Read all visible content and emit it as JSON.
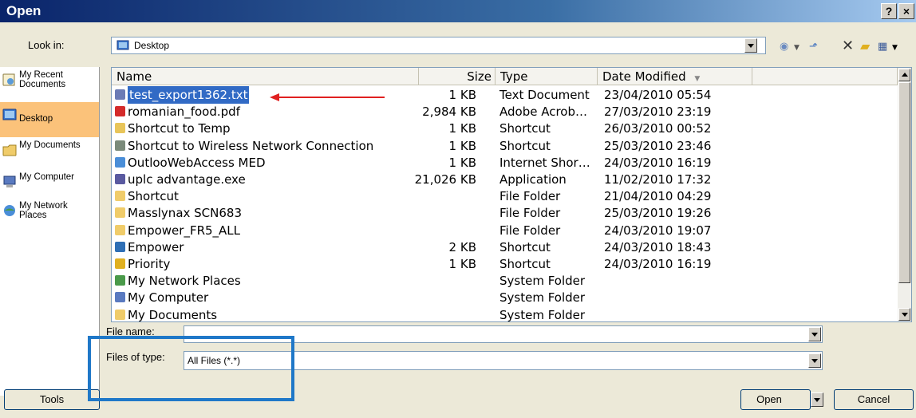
{
  "window": {
    "title": "Open",
    "help_glyph": "?",
    "close_glyph": "×"
  },
  "look_in": {
    "label": "Look in:",
    "value": "Desktop"
  },
  "places": [
    {
      "label": "My Recent Documents",
      "icon": "recent-documents-icon",
      "active": false
    },
    {
      "label": "Desktop",
      "icon": "desktop-icon",
      "active": true
    },
    {
      "label": "My Documents",
      "icon": "my-documents-icon",
      "active": false
    },
    {
      "label": "My Computer",
      "icon": "my-computer-icon",
      "active": false
    },
    {
      "label": "My Network Places",
      "icon": "network-places-icon",
      "active": false
    }
  ],
  "columns": {
    "name": "Name",
    "size": "Size",
    "type": "Type",
    "date": "Date Modified"
  },
  "files": [
    {
      "name": "test_export1362.txt",
      "size": "1 KB",
      "type": "Text Document",
      "date": "23/04/2010 05:54",
      "icon": "text-file-icon",
      "color": "#6b7bb5"
    },
    {
      "name": "romanian_food.pdf",
      "size": "2,984 KB",
      "type": "Adobe Acrob…",
      "date": "27/03/2010 23:19",
      "icon": "pdf-icon",
      "color": "#d42b2b"
    },
    {
      "name": "Shortcut to Temp",
      "size": "1 KB",
      "type": "Shortcut",
      "date": "26/03/2010 00:52",
      "icon": "folder-shortcut-icon",
      "color": "#e8c55a"
    },
    {
      "name": "Shortcut to Wireless Network Connection",
      "size": "1 KB",
      "type": "Shortcut",
      "date": "25/03/2010 23:46",
      "icon": "wireless-icon",
      "color": "#7a8a7a"
    },
    {
      "name": "OutlooWebAccess MED",
      "size": "1 KB",
      "type": "Internet Shor…",
      "date": "24/03/2010 16:19",
      "icon": "internet-shortcut-icon",
      "color": "#4a8ed8"
    },
    {
      "name": "uplc advantage.exe",
      "size": "21,026 KB",
      "type": "Application",
      "date": "11/02/2010 17:32",
      "icon": "application-icon",
      "color": "#5a5aa0"
    },
    {
      "name": "Shortcut",
      "size": "",
      "type": "File Folder",
      "date": "21/04/2010 04:29",
      "icon": "folder-icon",
      "color": "#f0cc6a"
    },
    {
      "name": "Masslynax SCN683",
      "size": "",
      "type": "File Folder",
      "date": "25/03/2010 19:26",
      "icon": "folder-icon",
      "color": "#f0cc6a"
    },
    {
      "name": "Empower_FR5_ALL",
      "size": "",
      "type": "File Folder",
      "date": "24/03/2010 19:07",
      "icon": "folder-icon",
      "color": "#f0cc6a"
    },
    {
      "name": "Empower",
      "size": "2 KB",
      "type": "Shortcut",
      "date": "24/03/2010 18:43",
      "icon": "empower-icon",
      "color": "#2f6fb5"
    },
    {
      "name": "Priority",
      "size": "1 KB",
      "type": "Shortcut",
      "date": "24/03/2010 16:19",
      "icon": "priority-icon",
      "color": "#e0b020"
    },
    {
      "name": "My Network Places",
      "size": "",
      "type": "System Folder",
      "date": "",
      "icon": "network-places-icon",
      "color": "#4a9a4a"
    },
    {
      "name": "My Computer",
      "size": "",
      "type": "System Folder",
      "date": "",
      "icon": "my-computer-icon",
      "color": "#5a7ac0"
    },
    {
      "name": "My Documents",
      "size": "",
      "type": "System Folder",
      "date": "",
      "icon": "my-documents-icon",
      "color": "#f0cc6a"
    }
  ],
  "file_name": {
    "label": "File name:",
    "value": ""
  },
  "files_of_type": {
    "label": "Files of type:",
    "value": "All Files (*.*)"
  },
  "buttons": {
    "tools": "Tools",
    "open": "Open",
    "cancel": "Cancel"
  },
  "colors": {
    "selection": "#316ac5",
    "annotation_arrow": "#e02020",
    "annotation_box": "#1f78c8",
    "active_place": "#fbc27a"
  }
}
